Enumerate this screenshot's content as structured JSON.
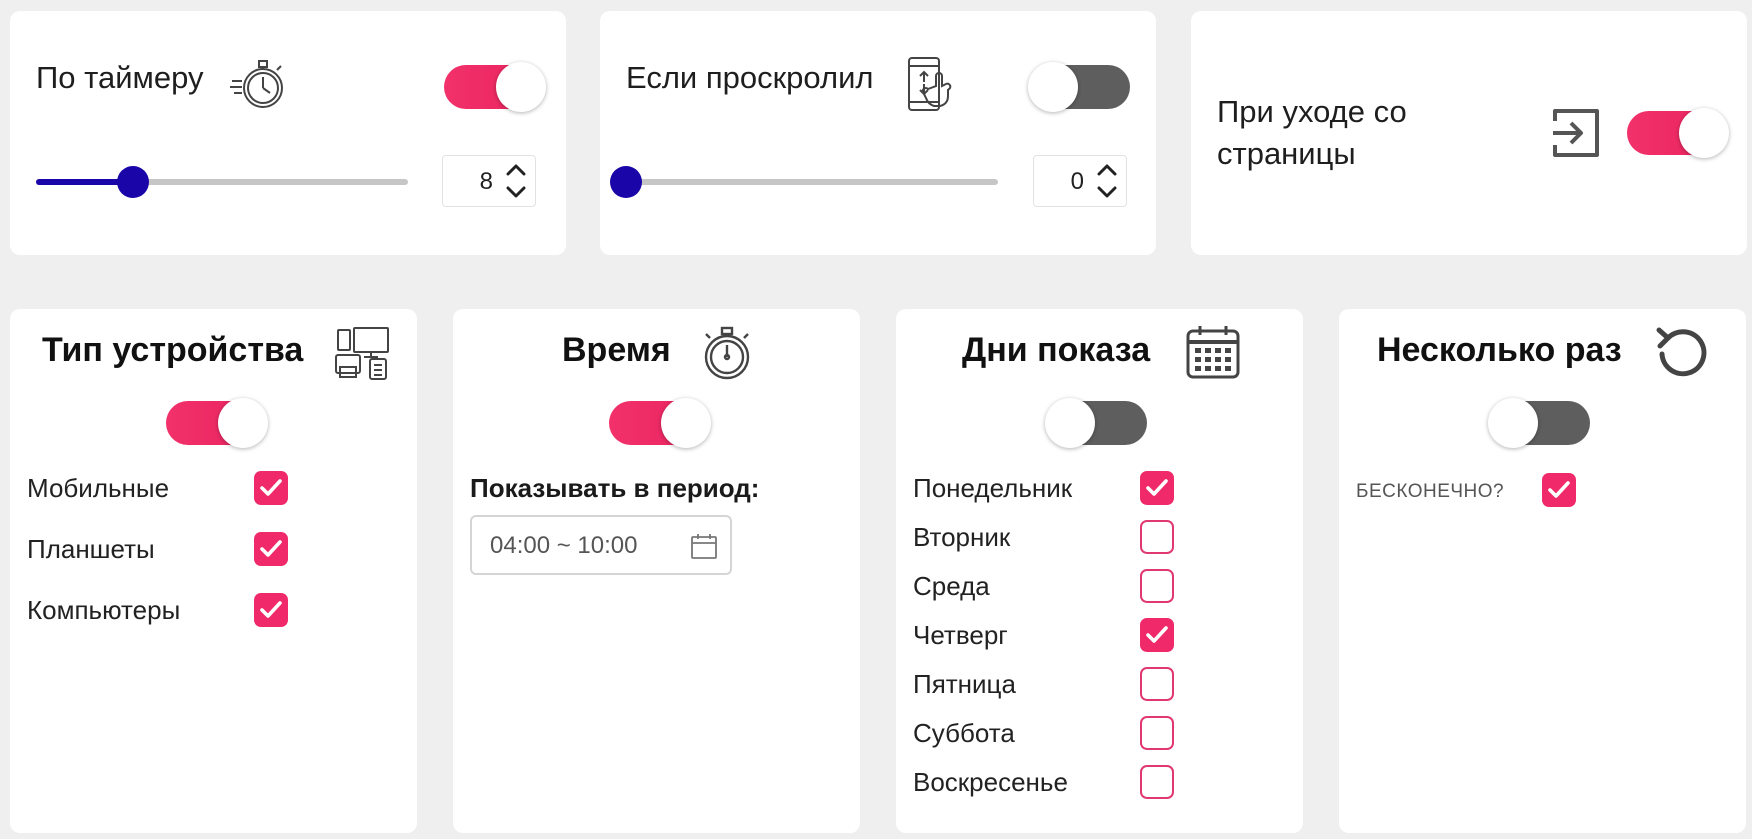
{
  "triggers": {
    "timer": {
      "label": "По таймеру",
      "enabled": true,
      "value": "8",
      "slider_fraction": 0.26
    },
    "scroll": {
      "label": "Если проскролил",
      "enabled": false,
      "value": "0",
      "slider_fraction": 0.0
    },
    "exit": {
      "label_line1": "При уходе со",
      "label_line2": "страницы",
      "enabled": true
    }
  },
  "device": {
    "title": "Тип устройства",
    "enabled": true,
    "items": [
      {
        "label": "Мобильные",
        "checked": true
      },
      {
        "label": "Планшеты",
        "checked": true
      },
      {
        "label": "Компьютеры",
        "checked": true
      }
    ]
  },
  "time": {
    "title": "Время",
    "enabled": true,
    "period_label": "Показывать в период:",
    "period_value": "04:00 ~ 10:00"
  },
  "days": {
    "title": "Дни показа",
    "enabled": false,
    "items": [
      {
        "label": "Понедельник",
        "checked": true
      },
      {
        "label": "Вторник",
        "checked": false
      },
      {
        "label": "Среда",
        "checked": false
      },
      {
        "label": "Четверг",
        "checked": true
      },
      {
        "label": "Пятница",
        "checked": false
      },
      {
        "label": "Суббота",
        "checked": false
      },
      {
        "label": "Воскресенье",
        "checked": false
      }
    ]
  },
  "repeat": {
    "title": "Несколько раз",
    "enabled": false,
    "infinite_label": "БЕСКОНЕЧНО?",
    "infinite_checked": true
  },
  "colors": {
    "accent": "#f0296a",
    "slider": "#1a06a8",
    "toggle_off": "#5e5e5e"
  },
  "icons": [
    "stopwatch-fast-icon",
    "phone-scroll-icon",
    "exit-icon",
    "devices-icon",
    "stopwatch-icon",
    "calendar-icon",
    "refresh-icon"
  ]
}
